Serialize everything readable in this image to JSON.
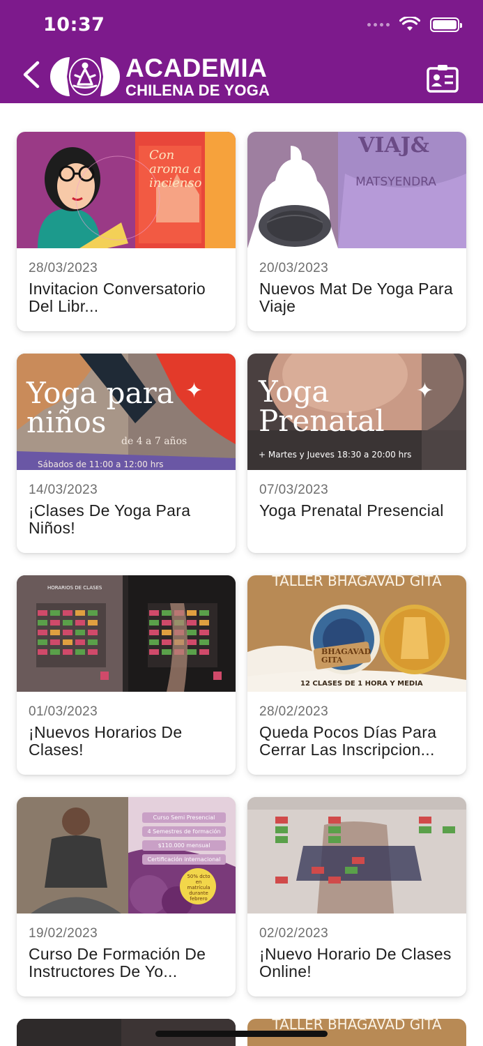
{
  "status_bar": {
    "time": "10:37"
  },
  "header": {
    "logo_line1": "ACADEMIA",
    "logo_line2": "CHILENA DE YOGA",
    "brand_color": "#7d1a8c"
  },
  "posts": [
    {
      "date": "28/03/2023",
      "title": "Invitacion Conversatorio Del Libr...",
      "image_text": "Con aroma a incienso"
    },
    {
      "date": "20/03/2023",
      "title": "Nuevos Mat De Yoga Para Viaje",
      "image_text": "VIAJ&",
      "image_sub": "MATSYENDRA"
    },
    {
      "date": "14/03/2023",
      "title": "¡Clases De Yoga Para Niños!",
      "image_text": "Yoga para niños",
      "image_sub": "de 4 a 7 años",
      "image_foot": "Sábados de 11:00 a 12:00 hrs"
    },
    {
      "date": "07/03/2023",
      "title": "Yoga Prenatal Presencial",
      "image_text": "Yoga Prenatal",
      "image_sub": "+ Martes y Jueves 18:30 a 20:00 hrs"
    },
    {
      "date": "01/03/2023",
      "title": "¡Nuevos Horarios De Clases!",
      "image_text": "HORARIOS DE CLASES"
    },
    {
      "date": "28/02/2023",
      "title": "Queda Pocos Días Para Cerrar Las Inscripcion...",
      "image_text": "TALLER BHAGAVAD GITA",
      "image_sub": "12 CLASES DE 1 HORA Y MEDIA",
      "image_badge": "BHAGAVAD GITA"
    },
    {
      "date": "19/02/2023",
      "title": "Curso De Formación De Instructores De Yo...",
      "image_lines": [
        "Curso Semi Presencial",
        "4 Semestres de formación",
        "$110.000 mensual",
        "Certificación internacional"
      ],
      "image_badge": "50% dcto en matrícula durante febrero"
    },
    {
      "date": "02/02/2023",
      "title": "¡Nuevo Horario De Clases Online!"
    }
  ],
  "partial_posts": [
    {
      "image_text": ""
    },
    {
      "image_text": "TALLER BHAGAVAD GITA"
    }
  ]
}
